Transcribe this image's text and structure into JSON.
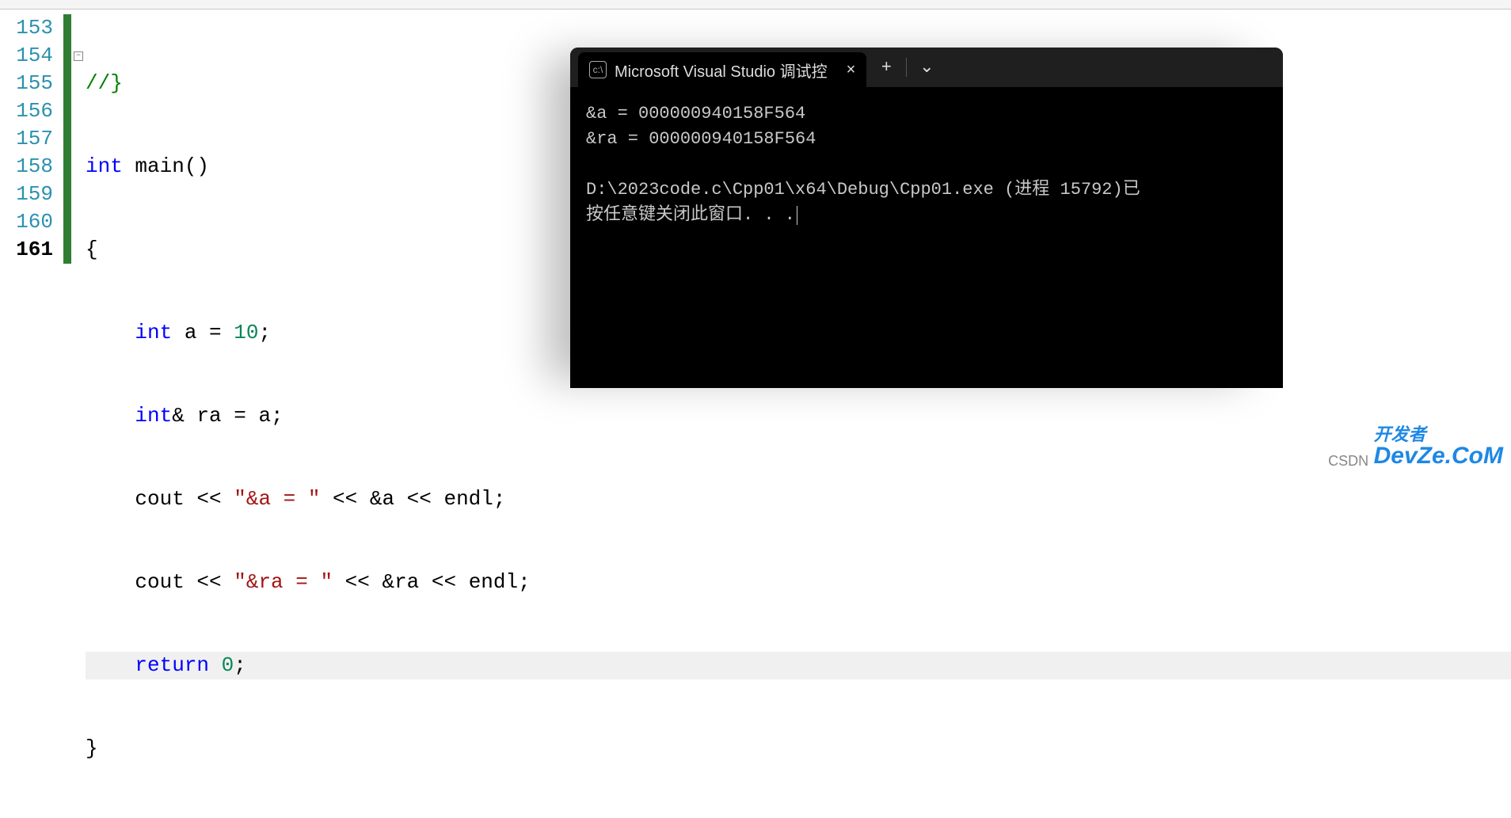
{
  "editor": {
    "lines": [
      {
        "num": "153",
        "bold": false,
        "changed": true
      },
      {
        "num": "154",
        "bold": false,
        "changed": true
      },
      {
        "num": "155",
        "bold": false,
        "changed": true
      },
      {
        "num": "156",
        "bold": false,
        "changed": true
      },
      {
        "num": "157",
        "bold": false,
        "changed": true
      },
      {
        "num": "158",
        "bold": false,
        "changed": true
      },
      {
        "num": "159",
        "bold": false,
        "changed": true
      },
      {
        "num": "160",
        "bold": false,
        "changed": true
      },
      {
        "num": "161",
        "bold": true,
        "changed": true
      }
    ],
    "fold_glyph": "−",
    "code": {
      "l153": "//}",
      "l154_kw": "int",
      "l154_rest": " main()",
      "l155": "{",
      "l156_kw": "int",
      "l156_rest1": " a = ",
      "l156_num": "10",
      "l156_rest2": ";",
      "l157_kw": "int",
      "l157_rest": "& ra = a;",
      "l158_a": "    cout << ",
      "l158_str": "\"&a = \"",
      "l158_b": " << &a << endl;",
      "l159_a": "    cout << ",
      "l159_str": "\"&ra = \"",
      "l159_b": " << &ra << endl;",
      "l160_kw": "return",
      "l160_rest1": " ",
      "l160_num": "0",
      "l160_rest2": ";",
      "l161": "}"
    }
  },
  "terminal": {
    "icon_text": "c:\\",
    "tab_title": "Microsoft Visual Studio 调试控",
    "close_glyph": "×",
    "plus_glyph": "+",
    "chevron_glyph": "⌄",
    "out_line1": "&a = 000000940158F564",
    "out_line2": "&ra = 000000940158F564",
    "out_line3": "D:\\2023code.c\\Cpp01\\x64\\Debug\\Cpp01.exe (进程 15792)已",
    "out_line4": "按任意键关闭此窗口. . ."
  },
  "watermark": {
    "prefix": "CSDN",
    "top": "开发者",
    "bottom": "DevZe.CoM"
  }
}
